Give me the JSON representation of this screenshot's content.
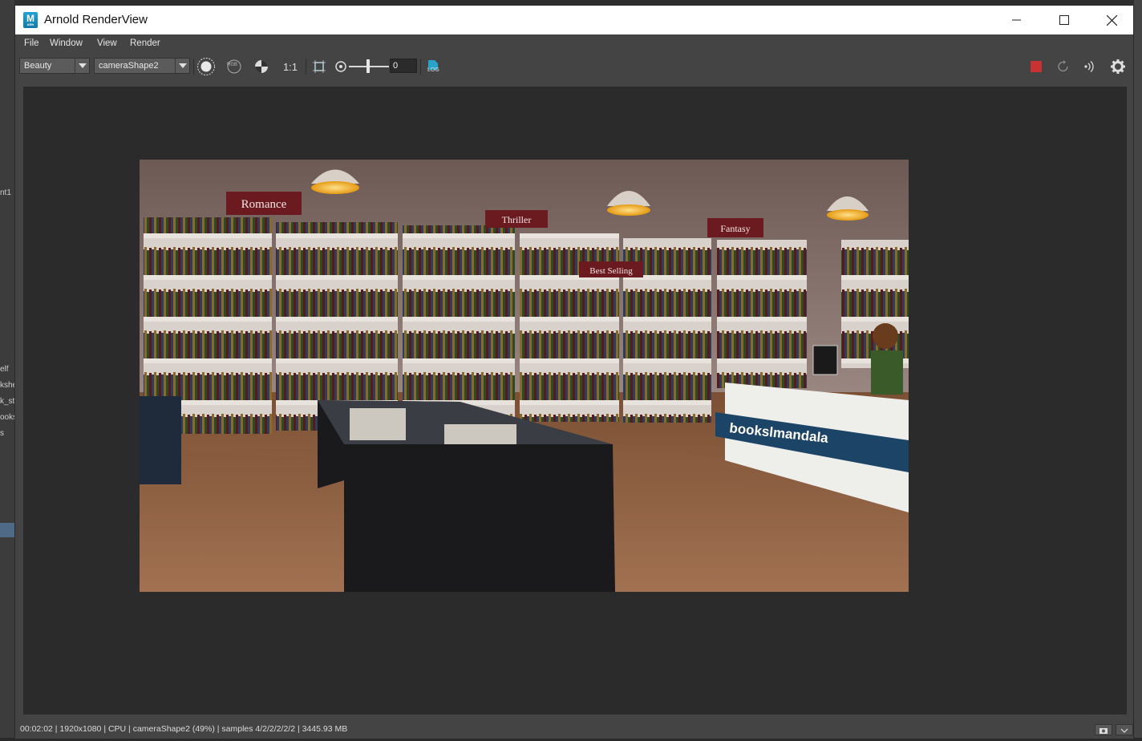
{
  "window": {
    "title": "Arnold RenderView",
    "app_icon_letter": "M",
    "app_icon_sub": "ARN"
  },
  "menu": [
    "File",
    "Window",
    "View",
    "Render"
  ],
  "toolbar": {
    "aov": "Beauty",
    "camera": "cameraShape2",
    "rgb_label": "RGB",
    "ratio_label": "1:1",
    "exposure_value": "0",
    "log_label": "LOG"
  },
  "render": {
    "signs": [
      "Romance",
      "Thriller",
      "Fantasy",
      "Best Selling"
    ],
    "counter_logo": "bookslmandala"
  },
  "status": "00:02:02 | 1920x1080 | CPU | cameraShape2 (49%) | samples 4/2/2/2/2/2 | 3445.93 MB",
  "background_fragments": [
    "nt1",
    "elf",
    "kshe",
    "k_st",
    "ooks",
    "s"
  ],
  "colors": {
    "accent_red": "#c83232",
    "sign_red": "#6b1a1f",
    "lamp_glow": "#f5b52a"
  }
}
